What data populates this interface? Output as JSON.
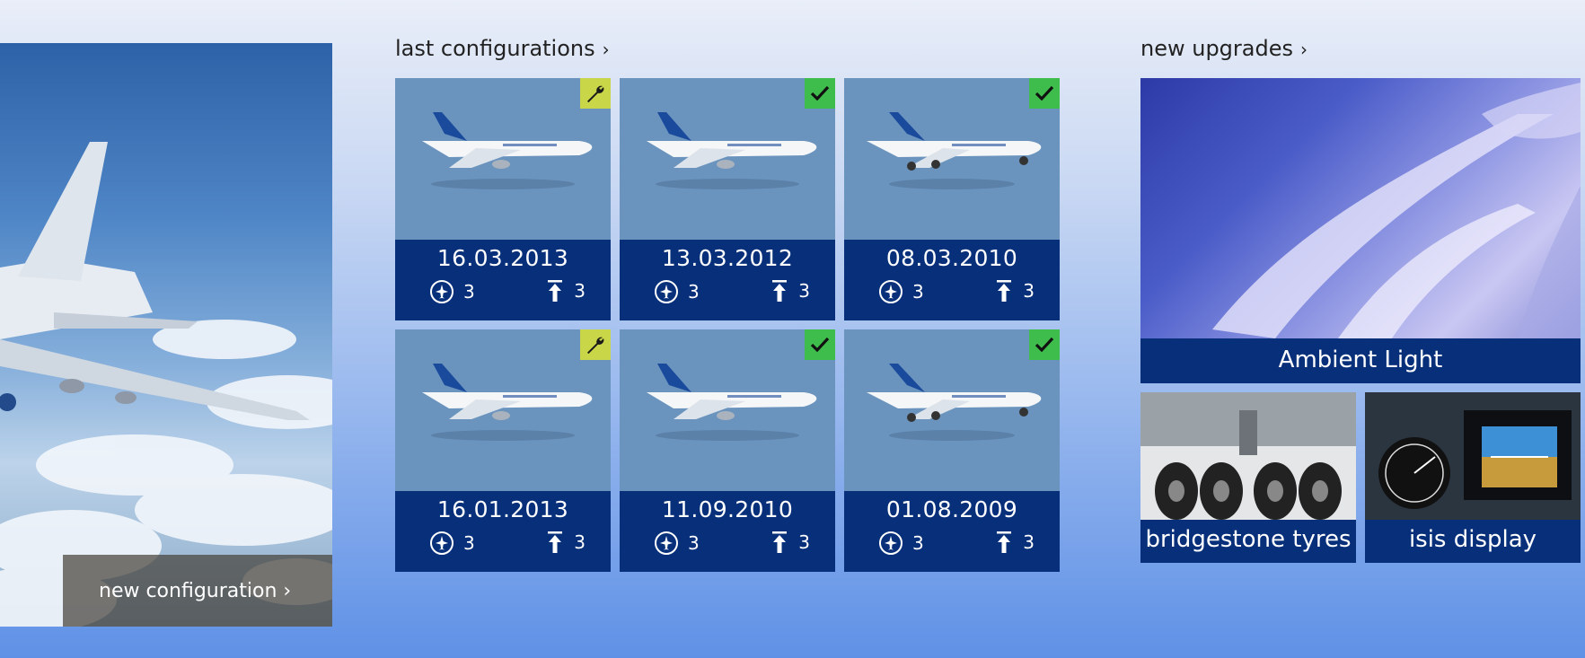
{
  "hero": {
    "cta_label": "new configuration"
  },
  "last_configurations": {
    "title": "last configurations",
    "chevron": "›",
    "tiles": [
      {
        "date": "16.03.2013",
        "planes": "3",
        "upgrades": "3",
        "status": "wrench-icon",
        "model": "narrowbody"
      },
      {
        "date": "13.03.2012",
        "planes": "3",
        "upgrades": "3",
        "status": "check-icon",
        "model": "narrowbody"
      },
      {
        "date": "08.03.2010",
        "planes": "3",
        "upgrades": "3",
        "status": "check-icon",
        "model": "widebody"
      },
      {
        "date": "16.01.2013",
        "planes": "3",
        "upgrades": "3",
        "status": "wrench-icon",
        "model": "narrowbody"
      },
      {
        "date": "11.09.2010",
        "planes": "3",
        "upgrades": "3",
        "status": "check-icon",
        "model": "narrowbody"
      },
      {
        "date": "01.08.2009",
        "planes": "3",
        "upgrades": "3",
        "status": "check-icon",
        "model": "widebody"
      }
    ]
  },
  "new_upgrades": {
    "title": "new upgrades",
    "chevron": "›",
    "items": [
      {
        "label": "Ambient Light"
      },
      {
        "label": "bridgestone tyres"
      },
      {
        "label": "isis display"
      }
    ]
  },
  "colors": {
    "tile_info": "#08307a",
    "tile_bg": "#6a94be",
    "badge_wrench": "#c8d648",
    "badge_check": "#3fbd4c"
  }
}
